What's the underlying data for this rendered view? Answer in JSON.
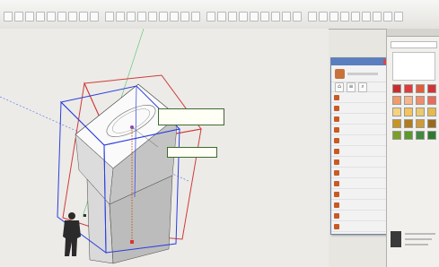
{
  "toolbar": {
    "icons": [
      "select-icon",
      "eraser-icon",
      "paint-icon",
      "line-icon",
      "rect-icon",
      "circle-icon",
      "arc-icon",
      "pushpull-icon",
      "move-icon",
      "rotate-icon",
      "scale-icon",
      "offset-icon",
      "tape-icon",
      "text-icon",
      "axes-icon",
      "orbit-icon",
      "pan-icon",
      "zoom-icon",
      "zoom-extents-icon",
      "previous-icon",
      "camera-icon",
      "walk-icon",
      "section-icon",
      "component-icon",
      "sandbox-icon",
      "style-icon",
      "layer-icon",
      "shadow-icon",
      "fog-icon",
      "match-icon",
      "warehouse-icon",
      "extension-icon",
      "ruby-icon",
      "plugin-icon",
      "render-icon",
      "settings-icon"
    ]
  },
  "tooltips": {
    "first": "",
    "second": ""
  },
  "plugin_panel": {
    "title": "",
    "rows": [
      "",
      "",
      "",
      "",
      "",
      "",
      "",
      "",
      "",
      "",
      "",
      "",
      ""
    ]
  },
  "side_panel": {
    "title": "",
    "swatches": [
      "#c82d2d",
      "#e03a3a",
      "#e45a3a",
      "#d23434",
      "#f29a6a",
      "#f6b58a",
      "#f08c6a",
      "#e96a5a",
      "#f5d27e",
      "#f4c35a",
      "#ecc96c",
      "#e7b94c",
      "#c89424",
      "#b07c1c",
      "#d09a34",
      "#9a6a1c",
      "#7aa02a",
      "#5a9a2a",
      "#3f8a3f",
      "#2f7a2f"
    ]
  },
  "colors": {
    "red_frame": "#d03a3a",
    "blue_frame": "#2c3ee0",
    "dotted": "#c85a24",
    "accent": "#5a7fc0"
  }
}
